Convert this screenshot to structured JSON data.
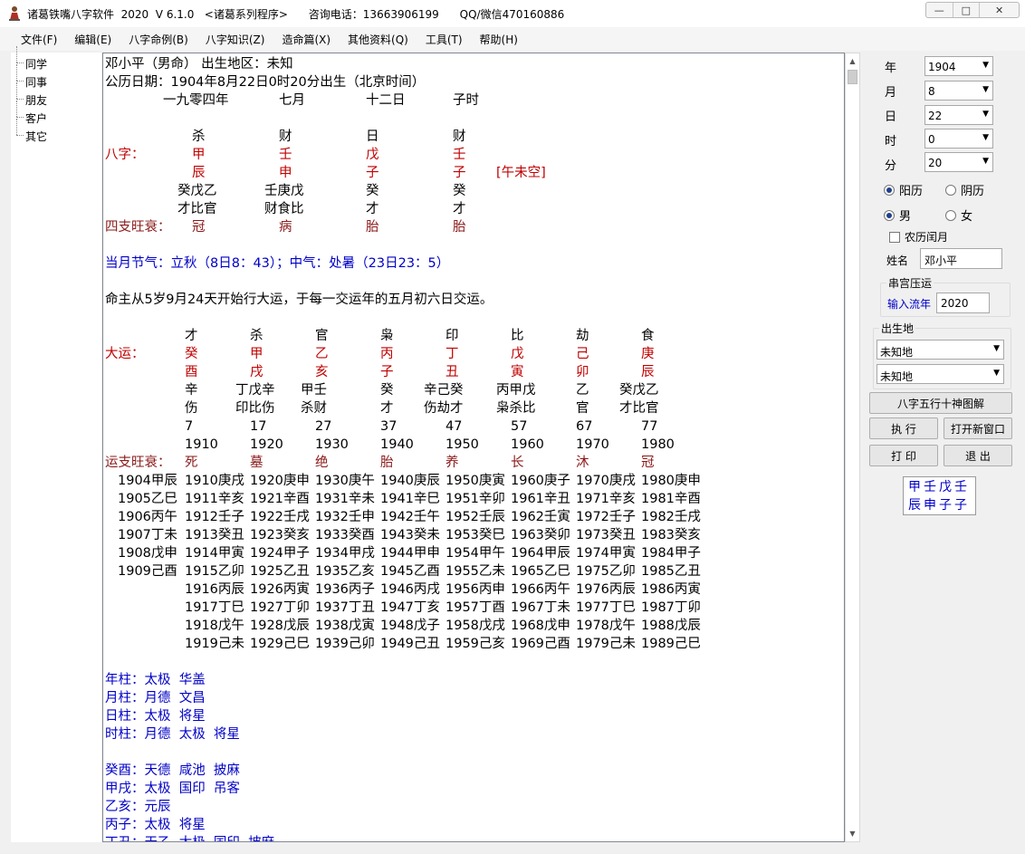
{
  "window": {
    "title": "诸葛铁嘴八字软件  2020  V 6.1.0   <诸葛系列程序>      咨询电话：13663906199      QQ/微信470160886",
    "buttons": {
      "minimize": "—",
      "maximize": "□",
      "close": "✕"
    }
  },
  "menu": [
    "文件(F)",
    "编辑(E)",
    "八字命例(B)",
    "八字知识(Z)",
    "造命篇(X)",
    "其他资料(Q)",
    "工具(T)",
    "帮助(H)"
  ],
  "tree": [
    "同学",
    "同事",
    "朋友",
    "客户",
    "其它"
  ],
  "report": {
    "name_line": "邓小平（男命） 出生地区：未知",
    "solar_line": "公历日期：1904年8月22日0时20分出生（北京时间）",
    "lunar": [
      "一九零四年",
      "七月",
      "十二日",
      "子时"
    ],
    "stems_gods": [
      "杀",
      "财",
      "日",
      "财"
    ],
    "bazi_label": "八字：",
    "stems": [
      "甲",
      "壬",
      "戊",
      "壬"
    ],
    "branches": [
      "辰",
      "申",
      "子",
      "子"
    ],
    "kongwang": "[午未空]",
    "hidden": [
      "癸戊乙",
      "壬庚戊",
      "癸",
      "癸"
    ],
    "hidden_gods": [
      "才比官",
      "财食比",
      "才",
      "才"
    ],
    "wangshuai_label": "四支旺衰：",
    "wangshuai": [
      "冠",
      "病",
      "胎",
      "胎"
    ],
    "jieqi": "当月节气：立秋（8日8：43）；中气：处暑（23日23：5）",
    "qiyun": "命主从5岁9月24天开始行大运，于每一交运年的五月初六日交运。",
    "dayun_gods": [
      "才",
      "杀",
      "官",
      "枭",
      "印",
      "比",
      "劫",
      "食"
    ],
    "dayun_label": "大运：",
    "dayun_stems": [
      "癸",
      "甲",
      "乙",
      "丙",
      "丁",
      "戊",
      "己",
      "庚"
    ],
    "dayun_branches": [
      "酉",
      "戌",
      "亥",
      "子",
      "丑",
      "寅",
      "卯",
      "辰"
    ],
    "dayun_hidden": [
      "辛",
      "丁戊辛",
      "甲壬",
      "癸",
      "辛己癸",
      "丙甲戊",
      "乙",
      "癸戊乙"
    ],
    "dayun_hidden_gods": [
      "伤",
      "印比伤",
      "杀财",
      "才",
      "伤劫才",
      "枭杀比",
      "官",
      "才比官"
    ],
    "dayun_ages": [
      "7",
      "17",
      "27",
      "37",
      "47",
      "57",
      "67",
      "77"
    ],
    "dayun_years": [
      "1910",
      "1920",
      "1930",
      "1940",
      "1950",
      "1960",
      "1970",
      "1980"
    ],
    "yun_ws_label": "运支旺衰：",
    "yun_ws": [
      "死",
      "墓",
      "绝",
      "胎",
      "养",
      "长",
      "沐",
      "冠"
    ],
    "year_rows": [
      [
        "1904甲辰",
        "1910庚戌",
        "1920庚申",
        "1930庚午",
        "1940庚辰",
        "1950庚寅",
        "1960庚子",
        "1970庚戌",
        "1980庚申"
      ],
      [
        "1905乙巳",
        "1911辛亥",
        "1921辛酉",
        "1931辛未",
        "1941辛巳",
        "1951辛卯",
        "1961辛丑",
        "1971辛亥",
        "1981辛酉"
      ],
      [
        "1906丙午",
        "1912壬子",
        "1922壬戌",
        "1932壬申",
        "1942壬午",
        "1952壬辰",
        "1962壬寅",
        "1972壬子",
        "1982壬戌"
      ],
      [
        "1907丁未",
        "1913癸丑",
        "1923癸亥",
        "1933癸酉",
        "1943癸未",
        "1953癸巳",
        "1963癸卯",
        "1973癸丑",
        "1983癸亥"
      ],
      [
        "1908戊申",
        "1914甲寅",
        "1924甲子",
        "1934甲戌",
        "1944甲申",
        "1954甲午",
        "1964甲辰",
        "1974甲寅",
        "1984甲子"
      ],
      [
        "1909己酉",
        "1915乙卯",
        "1925乙丑",
        "1935乙亥",
        "1945乙酉",
        "1955乙未",
        "1965乙巳",
        "1975乙卯",
        "1985乙丑"
      ],
      [
        "",
        "1916丙辰",
        "1926丙寅",
        "1936丙子",
        "1946丙戌",
        "1956丙申",
        "1966丙午",
        "1976丙辰",
        "1986丙寅"
      ],
      [
        "",
        "1917丁巳",
        "1927丁卯",
        "1937丁丑",
        "1947丁亥",
        "1957丁酉",
        "1967丁未",
        "1977丁巳",
        "1987丁卯"
      ],
      [
        "",
        "1918戊午",
        "1928戊辰",
        "1938戊寅",
        "1948戊子",
        "1958戊戌",
        "1968戊申",
        "1978戊午",
        "1988戊辰"
      ],
      [
        "",
        "1919己未",
        "1929己巳",
        "1939己卯",
        "1949己丑",
        "1959己亥",
        "1969己酉",
        "1979己未",
        "1989己巳"
      ]
    ],
    "pillar_stars": [
      "年柱：太极  华盖",
      "月柱：月德  文昌",
      "日柱：太极  将星",
      "时柱：月德  太极  将星"
    ],
    "yun_stars": [
      "癸酉：天德  咸池  披麻",
      "甲戌：太极  国印  吊客",
      "乙亥：元辰",
      "丙子：太极  将星",
      "丁丑：天乙  太极  国印  披麻"
    ]
  },
  "form": {
    "labels": {
      "year": "年",
      "month": "月",
      "day": "日",
      "hour": "时",
      "minute": "分"
    },
    "values": {
      "year": "1904",
      "month": "8",
      "day": "22",
      "hour": "0",
      "minute": "20"
    },
    "calendar": {
      "solar": "阳历",
      "lunar": "阴历",
      "selected": "solar"
    },
    "gender": {
      "male": "男",
      "female": "女",
      "selected": "male"
    },
    "leap_label": "农历闰月",
    "name_label": "姓名",
    "name_value": "邓小平",
    "chuangong_title": "串宫压运",
    "liunian_label": "输入流年",
    "liunian_value": "2020",
    "birthplace_title": "出生地",
    "province": "未知地",
    "city": "未知地",
    "btn_chart": "八字五行十神图解",
    "btn_run": "执  行",
    "btn_new": "打开新窗口",
    "btn_print": "打  印",
    "btn_exit": "退  出",
    "mini_stems": "甲壬戊壬",
    "mini_branches": "辰申子子"
  },
  "colors": {
    "red": "#c00000",
    "brown": "#8b1a1a",
    "blue": "#0000c8"
  }
}
